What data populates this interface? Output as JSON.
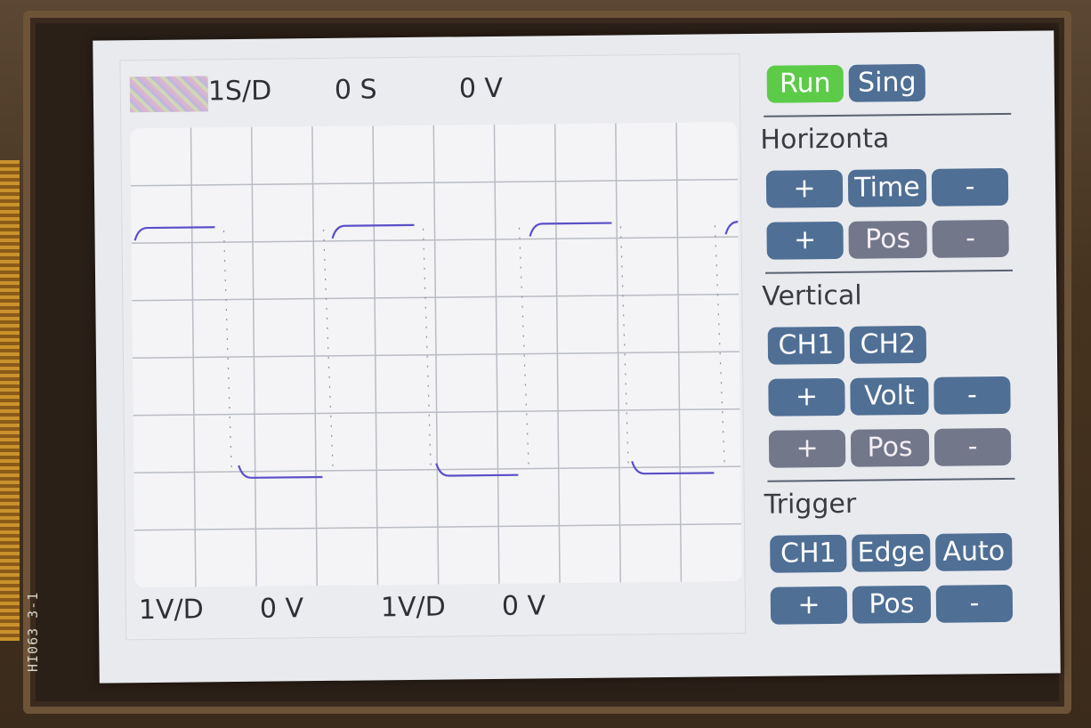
{
  "header": {
    "timebase": "1S/D",
    "time_offset": "0 S",
    "trigger_level": "0 V"
  },
  "footer": {
    "ch1_scale": "1V/D",
    "ch1_offset": "0 V",
    "ch2_scale": "1V/D",
    "ch2_offset": "0 V"
  },
  "silkscreen": "HI063 3-1",
  "menu": {
    "run_label": "Run",
    "single_label": "Sing",
    "horizontal": {
      "title": "Horizonta",
      "time": {
        "plus": "+",
        "label": "Time",
        "minus": "-"
      },
      "pos": {
        "plus": "+",
        "label": "Pos",
        "minus": "-"
      }
    },
    "vertical": {
      "title": "Vertical",
      "ch1": "CH1",
      "ch2": "CH2",
      "volt": {
        "plus": "+",
        "label": "Volt",
        "minus": "-"
      },
      "pos": {
        "plus": "+",
        "label": "Pos",
        "minus": "-"
      }
    },
    "trigger": {
      "title": "Trigger",
      "source": "CH1",
      "type": "Edge",
      "mode": "Auto",
      "pos": {
        "plus": "+",
        "label": "Pos",
        "minus": "-"
      }
    }
  },
  "colors": {
    "button": "#4f6f95",
    "run_button": "#5ccb48",
    "trace": "#5a4fc8",
    "grid": "#b9bcc4"
  }
}
